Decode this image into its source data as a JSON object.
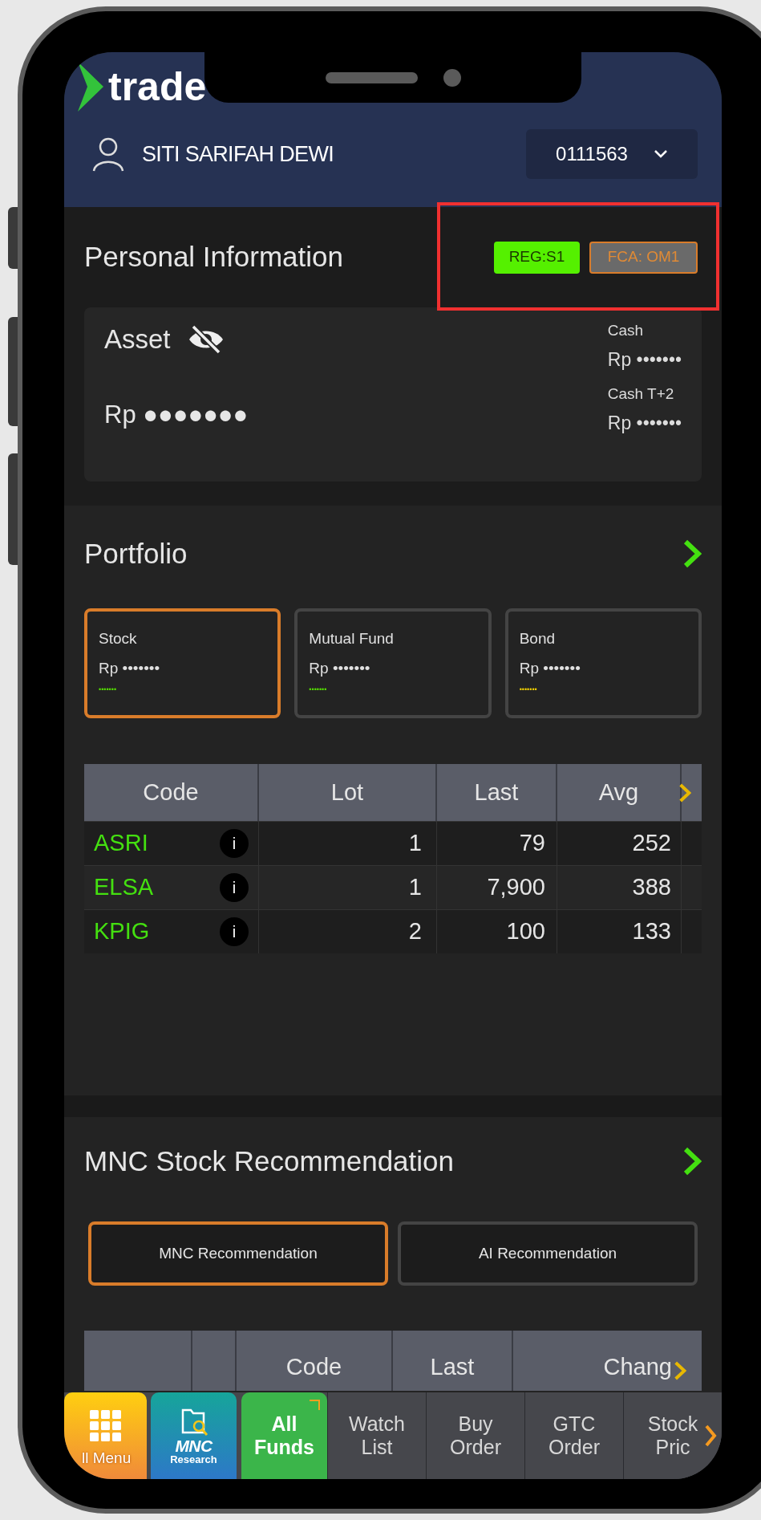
{
  "header": {
    "logo_text": "trade",
    "user_name": "SITI SARIFAH DEWI",
    "account": "0111563"
  },
  "personal_information": {
    "title": "Personal Information",
    "highlighted": true,
    "badges": [
      {
        "label": "REG:S1",
        "kind": "regular"
      },
      {
        "label": "FCA: OM1",
        "kind": "fca"
      }
    ],
    "asset_label": "Asset",
    "asset_value": "Rp ●●●●●●●",
    "cash": [
      {
        "label": "Cash",
        "value": "Rp •••••••"
      },
      {
        "label": "Cash T+2",
        "value": "Rp •••••••"
      }
    ]
  },
  "portfolio": {
    "title": "Portfolio",
    "cards": [
      {
        "label": "Stock",
        "value": "Rp •••••••",
        "sub": "•••••••",
        "color": "#55e000",
        "selected": true
      },
      {
        "label": "Mutual Fund",
        "value": "Rp •••••••",
        "sub": "•••••••",
        "color": "#55e000",
        "selected": false
      },
      {
        "label": "Bond",
        "value": "Rp •••••••",
        "sub": "•••••••",
        "color": "#f0d000",
        "selected": false
      }
    ],
    "table": {
      "columns": [
        "Code",
        "Lot",
        "Last",
        "Avg"
      ],
      "rows": [
        {
          "code": "ASRI",
          "info": "i",
          "lot": "1",
          "last": "79",
          "avg": "252"
        },
        {
          "code": "ELSA",
          "info": "i",
          "lot": "1",
          "last": "7,900",
          "avg": "388"
        },
        {
          "code": "KPIG",
          "info": "i",
          "lot": "2",
          "last": "100",
          "avg": "133"
        }
      ]
    }
  },
  "recommendation": {
    "title": "MNC Stock Recommendation",
    "tabs": [
      {
        "label": "MNC Recommendation",
        "selected": true
      },
      {
        "label": "AI Recommendation",
        "selected": false
      }
    ],
    "columns": [
      "Code",
      "Last",
      "Chang"
    ]
  },
  "bottom_nav": [
    {
      "kind": "menu",
      "label": "ll Menu"
    },
    {
      "kind": "research",
      "label": "MNC",
      "sub": "Research"
    },
    {
      "kind": "funds",
      "label": "All Funds"
    },
    {
      "kind": "plain",
      "label": "Watch List"
    },
    {
      "kind": "plain",
      "label": "Buy Order"
    },
    {
      "kind": "plain",
      "label": "GTC Order"
    },
    {
      "kind": "plain",
      "label": "Stock Pric"
    }
  ]
}
